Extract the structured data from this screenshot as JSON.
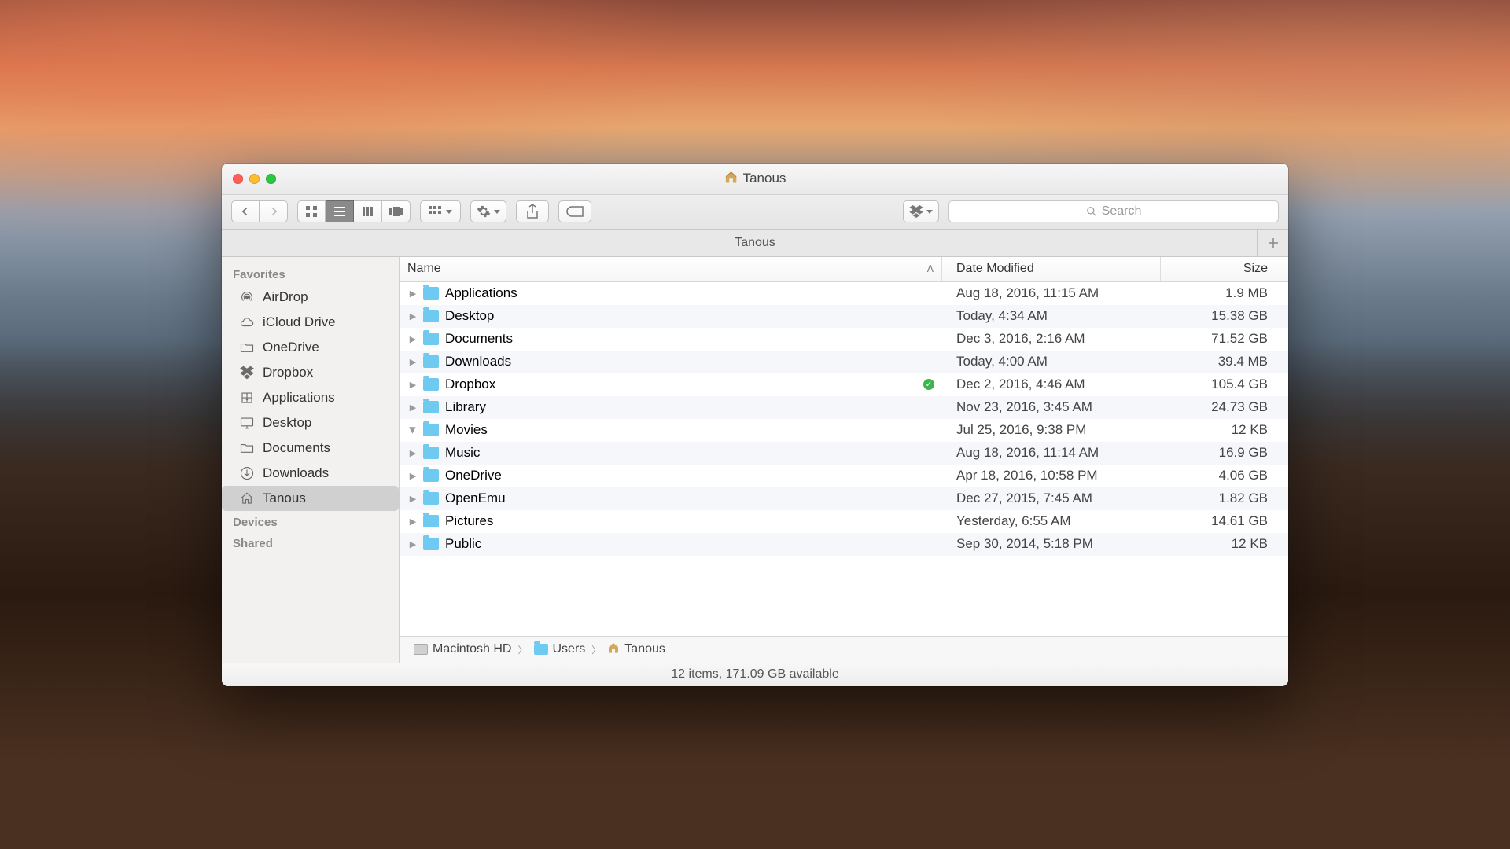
{
  "window": {
    "title": "Tanous"
  },
  "tabbar": {
    "active_tab": "Tanous"
  },
  "search": {
    "placeholder": "Search"
  },
  "sidebar": {
    "sections": [
      {
        "title": "Favorites",
        "items": [
          {
            "icon": "airdrop",
            "label": "AirDrop"
          },
          {
            "icon": "icloud",
            "label": "iCloud Drive"
          },
          {
            "icon": "folder",
            "label": "OneDrive"
          },
          {
            "icon": "dropbox",
            "label": "Dropbox"
          },
          {
            "icon": "apps",
            "label": "Applications"
          },
          {
            "icon": "desktop",
            "label": "Desktop"
          },
          {
            "icon": "folder",
            "label": "Documents"
          },
          {
            "icon": "downloads",
            "label": "Downloads"
          },
          {
            "icon": "home",
            "label": "Tanous",
            "selected": true
          }
        ]
      },
      {
        "title": "Devices",
        "items": []
      },
      {
        "title": "Shared",
        "items": []
      }
    ]
  },
  "columns": {
    "name": "Name",
    "date": "Date Modified",
    "size": "Size"
  },
  "rows": [
    {
      "name": "Applications",
      "date": "Aug 18, 2016, 11:15 AM",
      "size": "1.9 MB",
      "expanded": false
    },
    {
      "name": "Desktop",
      "date": "Today, 4:34 AM",
      "size": "15.38 GB",
      "expanded": false
    },
    {
      "name": "Documents",
      "date": "Dec 3, 2016, 2:16 AM",
      "size": "71.52 GB",
      "expanded": false
    },
    {
      "name": "Downloads",
      "date": "Today, 4:00 AM",
      "size": "39.4 MB",
      "expanded": false
    },
    {
      "name": "Dropbox",
      "date": "Dec 2, 2016, 4:46 AM",
      "size": "105.4 GB",
      "expanded": false,
      "synced": true
    },
    {
      "name": "Library",
      "date": "Nov 23, 2016, 3:45 AM",
      "size": "24.73 GB",
      "expanded": false
    },
    {
      "name": "Movies",
      "date": "Jul 25, 2016, 9:38 PM",
      "size": "12 KB",
      "expanded": true
    },
    {
      "name": "Music",
      "date": "Aug 18, 2016, 11:14 AM",
      "size": "16.9 GB",
      "expanded": false
    },
    {
      "name": "OneDrive",
      "date": "Apr 18, 2016, 10:58 PM",
      "size": "4.06 GB",
      "expanded": false,
      "cloud": true
    },
    {
      "name": "OpenEmu",
      "date": "Dec 27, 2015, 7:45 AM",
      "size": "1.82 GB",
      "expanded": false
    },
    {
      "name": "Pictures",
      "date": "Yesterday, 6:55 AM",
      "size": "14.61 GB",
      "expanded": false
    },
    {
      "name": "Public",
      "date": "Sep 30, 2014, 5:18 PM",
      "size": "12 KB",
      "expanded": false
    }
  ],
  "path": [
    {
      "icon": "hd",
      "label": "Macintosh HD"
    },
    {
      "icon": "folder",
      "label": "Users"
    },
    {
      "icon": "home",
      "label": "Tanous"
    }
  ],
  "status": "12 items, 171.09 GB available"
}
